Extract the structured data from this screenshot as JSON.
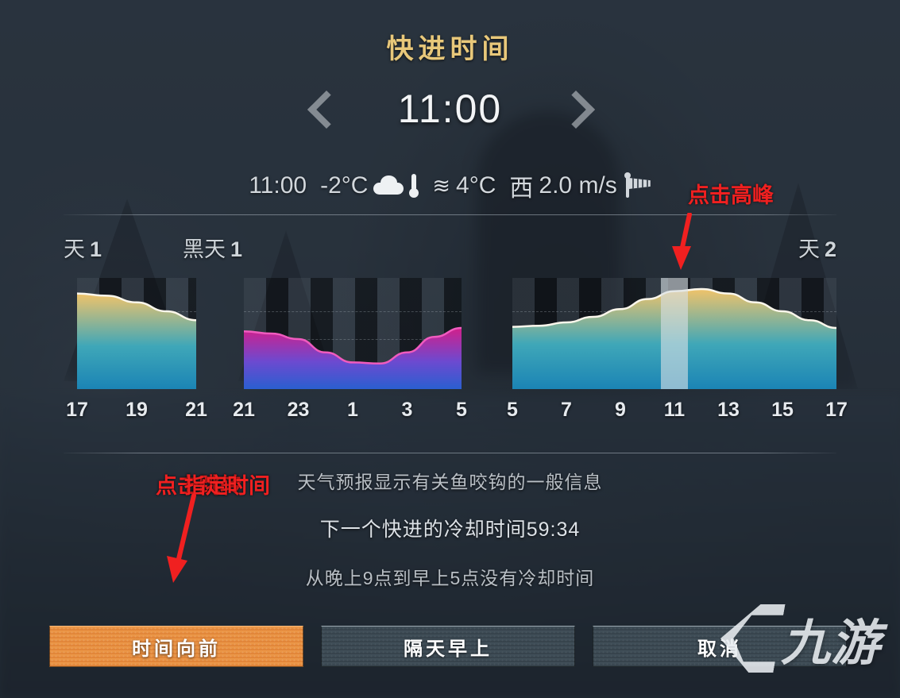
{
  "dialog": {
    "title": "快进时间",
    "clock": "11:00",
    "prev_icon": "chevron-left-icon",
    "next_icon": "chevron-right-icon"
  },
  "weather": {
    "time": "11:00",
    "air_temp": "-2°C",
    "cloud_icon": "cloud-icon",
    "thermometer_icon": "thermometer-icon",
    "water_waves_icon": "≋",
    "water_temp": "4°C",
    "wind_direction": "西",
    "wind_speed": "2.0 m/s",
    "windsock_icon": "windsock-icon"
  },
  "chart_data": {
    "type": "area",
    "title": "",
    "xlabel": "",
    "ylabel": "",
    "grid": true,
    "legend_position": "none",
    "current_hour": 11,
    "highlight_label": "11",
    "sections": [
      {
        "name": "天 1",
        "label_text": "天",
        "label_number": "1",
        "kind": "day",
        "gradient_top": "#f0c36a",
        "gradient_bottom": "#1b84b5",
        "ticks": [
          "17",
          "19",
          "21"
        ],
        "x": [
          17,
          18,
          19,
          20,
          21
        ],
        "values": [
          0.86,
          0.84,
          0.78,
          0.7,
          0.62
        ]
      },
      {
        "name": "黑天 1",
        "label_text": "黑天",
        "label_number": "1",
        "kind": "night",
        "gradient_top": "#d21f8a",
        "gradient_bottom": "#2a5fd0",
        "ticks": [
          "21",
          "23",
          "1",
          "3",
          "5"
        ],
        "x": [
          21,
          22,
          23,
          0,
          1,
          2,
          3,
          4,
          5
        ],
        "values": [
          0.52,
          0.5,
          0.45,
          0.33,
          0.24,
          0.23,
          0.33,
          0.47,
          0.55
        ]
      },
      {
        "name": "天 2",
        "label_text": "天",
        "label_number": "2",
        "kind": "day",
        "gradient_top": "#f0c36a",
        "gradient_bottom": "#1b84b5",
        "ticks": [
          "5",
          "7",
          "9",
          "11",
          "13",
          "15",
          "17"
        ],
        "x": [
          5,
          6,
          7,
          8,
          9,
          10,
          11,
          12,
          13,
          14,
          15,
          16,
          17
        ],
        "values": [
          0.56,
          0.57,
          0.6,
          0.65,
          0.72,
          0.81,
          0.88,
          0.9,
          0.86,
          0.78,
          0.7,
          0.62,
          0.55
        ]
      }
    ],
    "ylim": [
      0,
      1
    ],
    "gridlines": [
      0.45,
      0.7
    ]
  },
  "info": {
    "line1": "天气预报显示有关鱼咬钩的一般信息",
    "line2": "下一个快进的冷却时间59:34",
    "line3": "从晚上9点到早上5点没有冷却时间"
  },
  "buttons": [
    {
      "label": "时间向前",
      "style": "primary"
    },
    {
      "label": "隔天早上",
      "style": "secondary"
    },
    {
      "label": "取消",
      "style": "secondary"
    }
  ],
  "annotations": {
    "peak": "点击高峰",
    "jump_a": "点击跳转",
    "jump_b": "指定时间",
    "color": "#f02020"
  },
  "watermark": {
    "text": "九游"
  }
}
